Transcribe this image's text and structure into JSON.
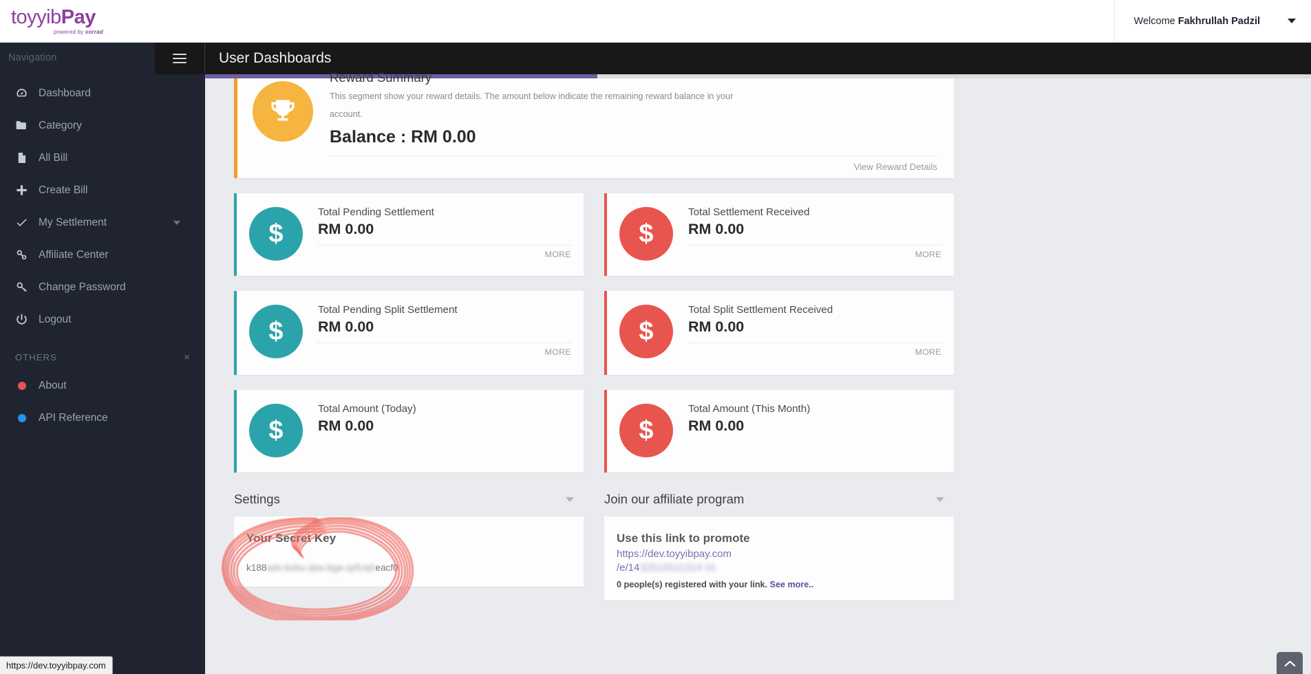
{
  "brand": {
    "part1": "toyyib",
    "part2": "Pay",
    "tagline_prefix": "powered by ",
    "tagline_brand": "xorrad"
  },
  "topbar": {
    "welcome_prefix": "Welcome ",
    "user_name": "Fakhrullah Padzil"
  },
  "sidebar": {
    "nav_title": "Navigation",
    "items": [
      {
        "label": "Dashboard",
        "icon": "dashboard-icon",
        "caret": false
      },
      {
        "label": "Category",
        "icon": "folder-icon",
        "caret": false
      },
      {
        "label": "All Bill",
        "icon": "file-icon",
        "caret": false
      },
      {
        "label": "Create Bill",
        "icon": "plus-icon",
        "caret": false
      },
      {
        "label": "My Settlement",
        "icon": "check-icon",
        "caret": true
      },
      {
        "label": "Affiliate Center",
        "icon": "link-icon",
        "caret": false
      },
      {
        "label": "Change Password",
        "icon": "key-icon",
        "caret": false
      },
      {
        "label": "Logout",
        "icon": "power-icon",
        "caret": false
      }
    ],
    "others_title": "OTHERS",
    "others_close": "×",
    "others_items": [
      {
        "label": "About",
        "color": "#e8554e"
      },
      {
        "label": "API Reference",
        "color": "#2196e8"
      }
    ]
  },
  "header": {
    "menu_icon": "hamburger-icon",
    "title": "User Dashboards"
  },
  "reward": {
    "icon": "trophy-icon",
    "title": "Reward Summary",
    "description": "This segment show your reward details. The amount below indicate the remaining reward balance in your account.",
    "balance": "Balance : RM 0.00",
    "link": "View Reward Details"
  },
  "stats": [
    {
      "title": "Total Pending Settlement",
      "value": "RM 0.00",
      "more": "MORE",
      "color": "teal",
      "icon": "dollar-icon"
    },
    {
      "title": "Total Settlement Received",
      "value": "RM 0.00",
      "more": "MORE",
      "color": "red",
      "icon": "dollar-icon"
    },
    {
      "title": "Total Pending Split Settlement",
      "value": "RM 0.00",
      "more": "MORE",
      "color": "teal",
      "icon": "dollar-icon"
    },
    {
      "title": "Total Split Settlement Received",
      "value": "RM 0.00",
      "more": "MORE",
      "color": "red",
      "icon": "dollar-icon"
    },
    {
      "title": "Total Amount (Today)",
      "value": "RM 0.00",
      "more": "",
      "color": "teal",
      "icon": "dollar-icon"
    },
    {
      "title": "Total Amount (This Month)",
      "value": "RM 0.00",
      "more": "",
      "color": "red",
      "icon": "dollar-icon"
    }
  ],
  "settings_panel": {
    "title": "Settings",
    "secret_label": "Your Secret Key",
    "secret_prefix": "k188",
    "secret_masked": "adv-bvbu-aba-bga-spfUq0",
    "secret_suffix": "eacf0"
  },
  "affiliate_panel": {
    "title": "Join our affiliate program",
    "heading": "Use this link to promote",
    "link_line1": "https://dev.toyyibpay.com",
    "link_line2_prefix": "/e/14",
    "link_line2_masked": "32510511314 01",
    "note": "0 people(s) registered with your link. ",
    "note_link": "See more.."
  },
  "statusbar": {
    "url": "https://dev.toyyibpay.com"
  },
  "scroll_top": {
    "icon": "chevron-up-icon"
  },
  "colors": {
    "brand_purple": "#8e3f9e",
    "accent_purple": "#6c5fa0",
    "teal": "#2ba3ab",
    "red": "#e8554e",
    "orange": "#f5b53f",
    "sidebar_bg": "#1f2430",
    "header_bg": "#181818",
    "content_bg": "#eaebef",
    "annotation_red": "#ef6a63"
  }
}
